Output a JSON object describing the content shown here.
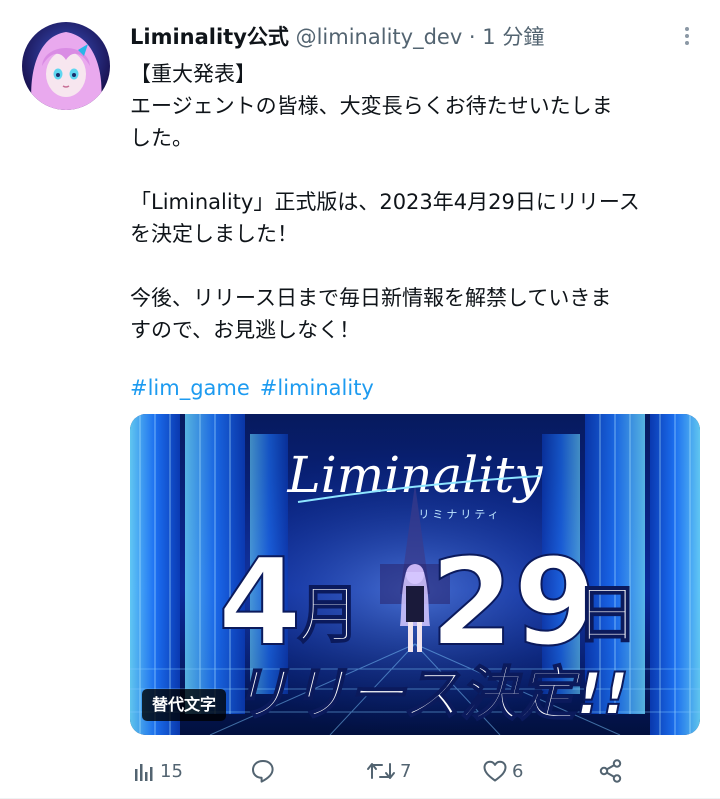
{
  "tweet": {
    "display_name": "Liminality公式",
    "handle": "@liminality_dev",
    "separator": " · ",
    "time": "1 分鐘",
    "body": "【重大発表】\nエージェントの皆様、大変長らくお待たせいたしま\nした。\n\n「Liminality」正式版は、2023年4月29日にリリース\nを決定しました！\n\n今後、リリース日まで毎日新情報を解禁していきま\nすので、お見逃しなく！",
    "hashtags": [
      "#lim_game",
      "#liminality"
    ]
  },
  "media": {
    "logo_text": "Liminality",
    "logo_kana": "リミナリティ",
    "date_month_num": "4",
    "date_month_kanji": "月",
    "date_day_num": "29",
    "date_day_kanji": "日",
    "release_text": "リリース決定!!",
    "alt_badge": "替代文字"
  },
  "actions": {
    "views": "15",
    "reply": "",
    "retweets": "7",
    "likes": "6"
  },
  "colors": {
    "accent": "#1d9bf0",
    "text": "#0f1419",
    "muted": "#536471"
  },
  "icons": [
    "more-options-icon",
    "views-chart-icon",
    "reply-icon",
    "retweet-icon",
    "like-heart-icon",
    "share-icon"
  ]
}
